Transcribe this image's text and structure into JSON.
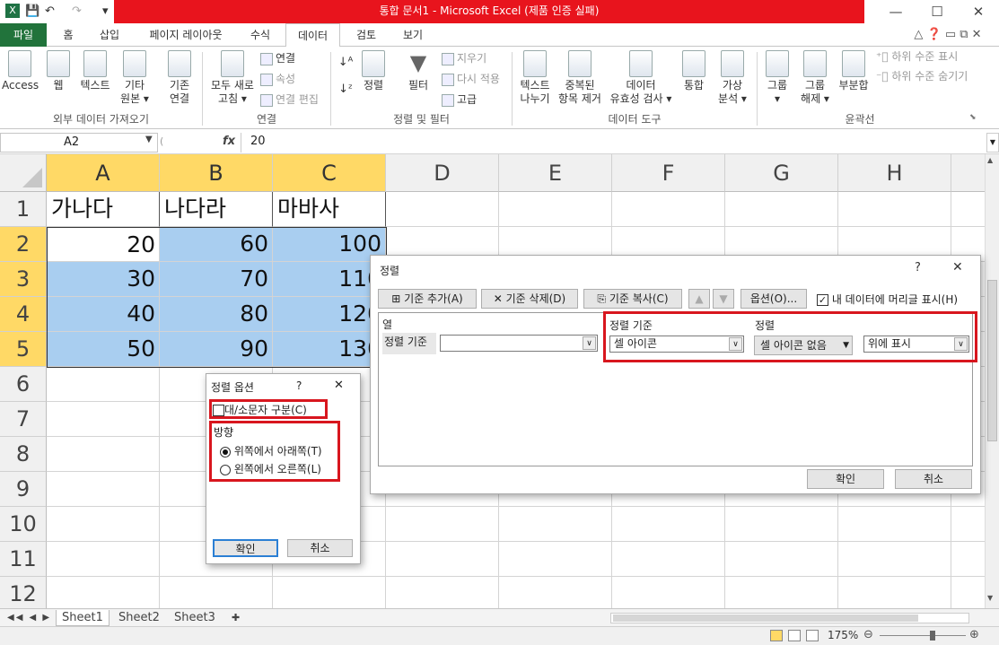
{
  "window": {
    "title": "통합 문서1 - Microsoft Excel (제품 인증 실패)"
  },
  "qat": {
    "save": "💾",
    "undo": "↶",
    "redo": "↷"
  },
  "tabs": [
    "파일",
    "홈",
    "삽입",
    "페이지 레이아웃",
    "수식",
    "데이터",
    "검토",
    "보기"
  ],
  "ribbon": {
    "access": "Access",
    "web": "웹",
    "text": "텍스트",
    "other1": "기타",
    "other2": "원본 ▾",
    "existing1": "기존",
    "existing2": "연결",
    "refresh1": "모두 새로",
    "refresh2": "고침 ▾",
    "conn": "연결",
    "props": "속성",
    "edit_links": "연결 편집",
    "group_ext": "외부 데이터 가져오기",
    "group_conn": "연결",
    "sort": "정렬",
    "filter": "필터",
    "clear": "지우기",
    "reapply": "다시 적용",
    "advanced": "고급",
    "group_sort": "정렬 및 필터",
    "t2c1": "텍스트",
    "t2c2": "나누기",
    "dup1": "중복된",
    "dup2": "항목 제거",
    "dv1": "데이터",
    "dv2": "유효성 검사 ▾",
    "consol": "통합",
    "whatif1": "가상",
    "whatif2": "분석 ▾",
    "group_tools": "데이터 도구",
    "group1": "그룹",
    "group1b": "▾",
    "ungroup1": "그룹",
    "ungroup2": "해제 ▾",
    "subtotal": "부분합",
    "show_detail": "하위 수준 표시",
    "hide_detail": "하위 수준 숨기기",
    "group_outline": "윤곽선"
  },
  "formula": {
    "namebox": "A2",
    "fx": "fx",
    "value": "20"
  },
  "columns": [
    "A",
    "B",
    "C",
    "D",
    "E",
    "F",
    "G",
    "H"
  ],
  "rows": [
    "1",
    "2",
    "3",
    "4",
    "5",
    "6",
    "7",
    "8",
    "9",
    "10",
    "11",
    "12"
  ],
  "cells": {
    "r1": [
      "가나다",
      "나다라",
      "마바사"
    ],
    "r2": [
      "20",
      "60",
      "100"
    ],
    "r3": [
      "30",
      "70",
      "110"
    ],
    "r4": [
      "40",
      "80",
      "120"
    ],
    "r5": [
      "50",
      "90",
      "130"
    ]
  },
  "sheets": [
    "Sheet1",
    "Sheet2",
    "Sheet3"
  ],
  "status": {
    "zoom": "175%"
  },
  "sort_dialog": {
    "title": "정렬",
    "help": "?",
    "close": "✕",
    "add_level": "기준 추가(A)",
    "delete_level": "기준 삭제(D)",
    "copy_level": "기준 복사(C)",
    "options": "옵션(O)...",
    "header_checkbox": "내 데이터에 머리글 표시(H)",
    "col_header": "열",
    "sort_on_header": "정렬 기준",
    "order_header": "정렬",
    "row_label": "정렬 기준",
    "column_value": "",
    "sort_on_value": "셀 아이콘",
    "icon_value": "셀 아이콘 없음",
    "order_value": "위에 표시",
    "ok": "확인",
    "cancel": "취소"
  },
  "options_dialog": {
    "title": "정렬 옵션",
    "help": "?",
    "close": "✕",
    "case_sensitive": "대/소문자 구분(C)",
    "orientation": "방향",
    "top_to_bottom": "위쪽에서 아래쪽(T)",
    "left_to_right": "왼쪽에서 오른쪽(L)",
    "ok": "확인",
    "cancel": "취소"
  },
  "colors": {
    "accent_red": "#d8161e",
    "excel_green": "#21733b",
    "selection_blue": "#a9cef0",
    "header_yellow": "#ffd966"
  }
}
